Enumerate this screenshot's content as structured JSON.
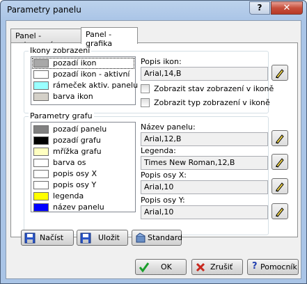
{
  "window": {
    "title": "Parametry panelu",
    "help_label": "?",
    "close_label": "✕"
  },
  "tabs": [
    {
      "label": "Panel - zobrazení",
      "active": false
    },
    {
      "label": "Panel - grafika",
      "active": true
    }
  ],
  "icons_group": {
    "title": "Ikony zobrazení",
    "items": [
      {
        "label": "pozadí ikon",
        "color": "#a8a8a8",
        "selected": true
      },
      {
        "label": "pozadí ikon - aktivní",
        "color": "#ffffff",
        "selected": false
      },
      {
        "label": "rámeček aktiv. panelu",
        "color": "#99ffff",
        "selected": false
      },
      {
        "label": "barva ikon",
        "color": "#d4d0c8",
        "selected": false
      }
    ],
    "font_label": "Popis ikon:",
    "font_value": "Arial,14,B",
    "check1": "Zobrazit stav zobrazení v ikoně",
    "check2": "Zobrazit typ zobrazení v ikoně"
  },
  "graph_group": {
    "title": "Parametry grafu",
    "items": [
      {
        "label": "pozadí panelu",
        "color": "#808080"
      },
      {
        "label": "pozadí grafu",
        "color": "#000000"
      },
      {
        "label": "mřížka grafu",
        "color": "#ffffc0"
      },
      {
        "label": "barva os",
        "color": "#ffffff"
      },
      {
        "label": "popis osy X",
        "color": "#ffffff"
      },
      {
        "label": "popis osy Y",
        "color": "#ffffff"
      },
      {
        "label": "legenda",
        "color": "#ffff00"
      },
      {
        "label": "název panelu",
        "color": "#0000ff"
      }
    ],
    "fields": [
      {
        "label": "Název panelu:",
        "value": "Arial,12,B"
      },
      {
        "label": "Legenda:",
        "value": "Times New Roman,12,B"
      },
      {
        "label": "Popis osy X:",
        "value": "Arial,10"
      },
      {
        "label": "Popis osy Y:",
        "value": "Arial,10"
      }
    ]
  },
  "actions": {
    "load": "Načíst",
    "save": "Uložit",
    "standard": "Standard"
  },
  "footer": {
    "ok": "OK",
    "cancel": "Zrušiť",
    "help": "Pomocník"
  }
}
